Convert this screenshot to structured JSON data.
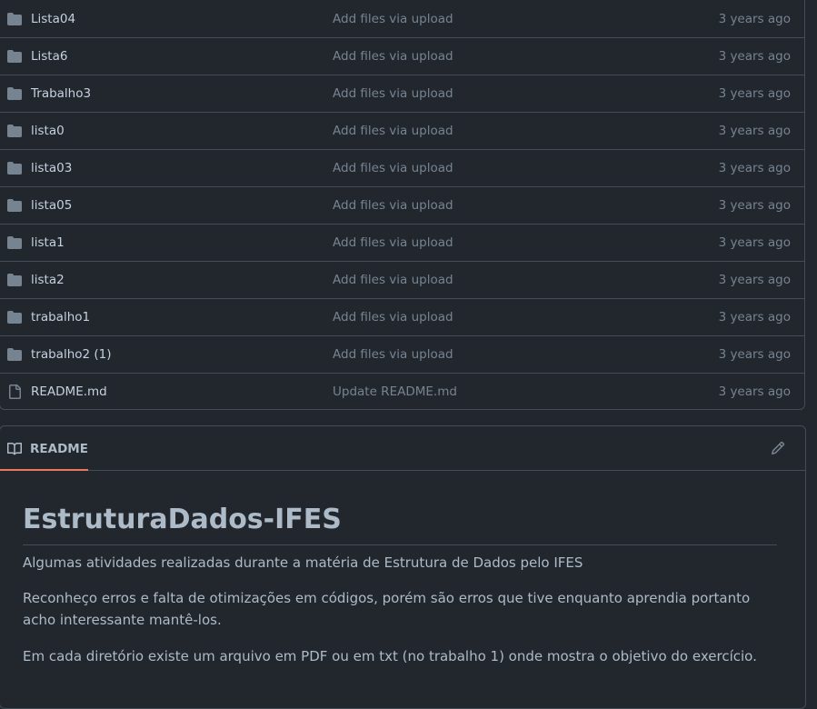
{
  "files": [
    {
      "name": "Lista04",
      "type": "folder",
      "icon": "folder-icon",
      "message": "Add files via upload",
      "age": "3 years ago"
    },
    {
      "name": "Lista6",
      "type": "folder",
      "icon": "folder-icon",
      "message": "Add files via upload",
      "age": "3 years ago"
    },
    {
      "name": "Trabalho3",
      "type": "folder",
      "icon": "folder-icon",
      "message": "Add files via upload",
      "age": "3 years ago"
    },
    {
      "name": "lista0",
      "type": "folder",
      "icon": "folder-icon",
      "message": "Add files via upload",
      "age": "3 years ago"
    },
    {
      "name": "lista03",
      "type": "folder",
      "icon": "folder-icon",
      "message": "Add files via upload",
      "age": "3 years ago"
    },
    {
      "name": "lista05",
      "type": "folder",
      "icon": "folder-icon",
      "message": "Add files via upload",
      "age": "3 years ago"
    },
    {
      "name": "lista1",
      "type": "folder",
      "icon": "folder-icon",
      "message": "Add files via upload",
      "age": "3 years ago"
    },
    {
      "name": "lista2",
      "type": "folder",
      "icon": "folder-icon",
      "message": "Add files via upload",
      "age": "3 years ago"
    },
    {
      "name": "trabalho1",
      "type": "folder",
      "icon": "folder-icon",
      "message": "Add files via upload",
      "age": "3 years ago"
    },
    {
      "name": "trabalho2 (1)",
      "type": "folder",
      "icon": "folder-icon",
      "message": "Add files via upload",
      "age": "3 years ago"
    },
    {
      "name": "README.md",
      "type": "file",
      "icon": "file-icon",
      "message": "Update README.md",
      "age": "3 years ago"
    }
  ],
  "readme": {
    "tab_label": "README",
    "tab_icon": "book-icon",
    "edit_icon": "pencil-icon",
    "title": "EstruturaDados-IFES",
    "paragraphs": [
      "Algumas atividades realizadas durante a matéria de Estrutura de Dados pelo IFES",
      "Reconheço erros e falta de otimizações em códigos, porém são erros que tive enquanto aprendia portanto acho interessante mantê-los.",
      "Em cada diretório existe um arquivo em PDF ou em txt (no trabalho 1) onde mostra o objetivo do exercício."
    ]
  },
  "colors": {
    "background": "#22272e",
    "border": "#444c56",
    "text": "#adbac7",
    "muted": "#768390",
    "icon": "#768390",
    "accent": "#ec775c"
  }
}
